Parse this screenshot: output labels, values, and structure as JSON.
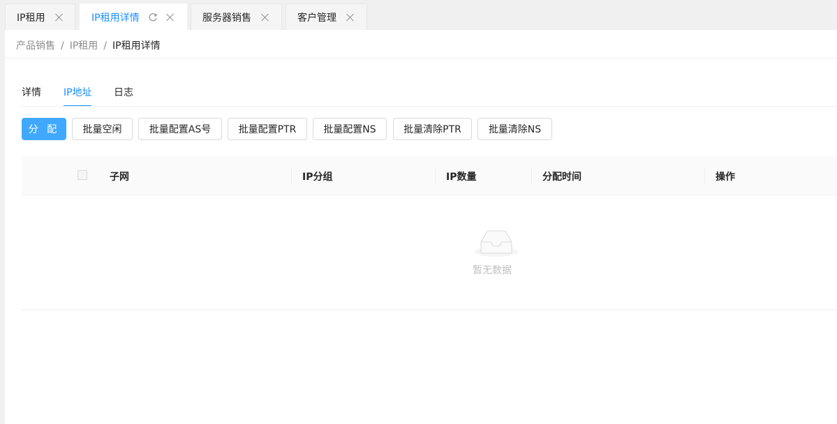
{
  "tabs": [
    {
      "label": "IP租用"
    },
    {
      "label": "IP租用详情"
    },
    {
      "label": "服务器销售"
    },
    {
      "label": "客户管理"
    }
  ],
  "breadcrumb": [
    "产品销售",
    "IP租用",
    "IP租用详情"
  ],
  "breadcrumb_sep": "/",
  "subtabs": [
    "详情",
    "IP地址",
    "日志"
  ],
  "buttons": {
    "assign": "分 配",
    "batch_idle": "批量空闲",
    "batch_as": "批量配置AS号",
    "batch_ptr": "批量配置PTR",
    "batch_ns": "批量配置NS",
    "clear_ptr": "批量清除PTR",
    "clear_ns": "批量清除NS"
  },
  "table": {
    "columns": [
      "子网",
      "IP分组",
      "IP数量",
      "分配时间",
      "操作"
    ],
    "empty_text": "暂无数据"
  },
  "colors": {
    "accent": "#1890ff",
    "primary_button": "#40a9ff"
  }
}
